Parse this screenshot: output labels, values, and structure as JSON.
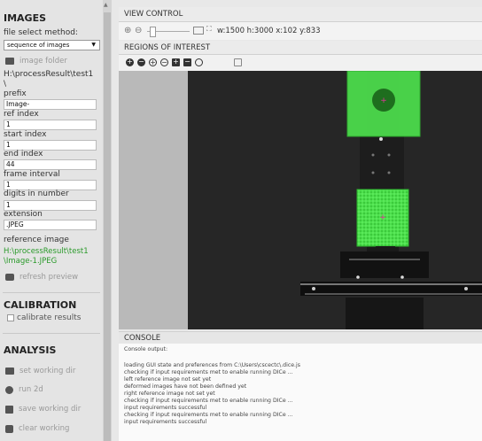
{
  "images": {
    "heading": "IMAGES",
    "file_select_label": "file select method:",
    "file_select_value": "sequence of images",
    "image_folder_button": "image folder",
    "folder_path_line1": "H:\\processResult\\test1",
    "folder_path_line2": "\\",
    "prefix_label": "prefix",
    "prefix_value": "Image-",
    "ref_index_label": "ref index",
    "ref_index_value": "1",
    "start_index_label": "start index",
    "start_index_value": "1",
    "end_index_label": "end index",
    "end_index_value": "44",
    "frame_interval_label": "frame interval",
    "frame_interval_value": "1",
    "digits_label": "digits in number",
    "digits_value": "1",
    "extension_label": "extension",
    "extension_value": ".JPEG",
    "reference_image_label": "reference image",
    "reference_image_line1": "H:\\processResult\\test1",
    "reference_image_line2": "\\Image-1.JPEG",
    "refresh_preview_button": "refresh preview"
  },
  "calibration": {
    "heading": "CALIBRATION",
    "calibrate_label": "calibrate results"
  },
  "analysis": {
    "heading": "ANALYSIS",
    "set_working_dir": "set working dir",
    "run_2d": "run 2d",
    "save_working_dir": "save working dir",
    "clear_working": "clear working"
  },
  "view_control": {
    "title": "VIEW CONTROL",
    "zoom_in_glyph": "⊕",
    "zoom_out_glyph": "⊖",
    "status": "w:1500 h:3000 x:102 y:833",
    "zoom_level": 0.1
  },
  "roi": {
    "title": "REGIONS OF INTEREST"
  },
  "console": {
    "title": "CONSOLE",
    "lines": [
      "Console output:",
      "",
      "loading GUI state and preferences from C:\\Users\\cscectc\\.dice.js",
      "checking if input requirements met to enable running DICe ...",
      "left reference image not set yet",
      "deformed images have not been defined yet",
      "right reference image not set yet",
      "checking if input requirements met to enable running DICe ...",
      "input requirements successful",
      "checking if input requirements met to enable running DICe ...",
      "input requirements successful"
    ]
  },
  "colors": {
    "green_text": "#2a9a2a",
    "roi_fill": "#4de04d",
    "roi_border": "#2fb52f",
    "marker": "#e0359a"
  }
}
